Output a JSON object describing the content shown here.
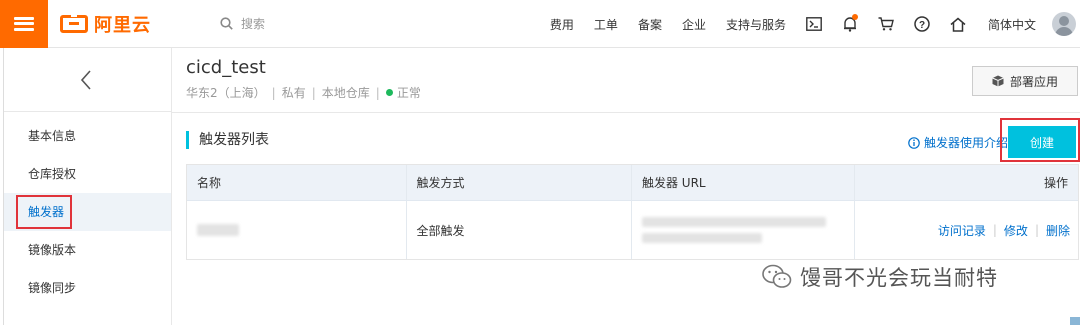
{
  "header": {
    "logo_text": "阿里云",
    "search_placeholder": "搜索",
    "nav": [
      "费用",
      "工单",
      "备案",
      "企业",
      "支持与服务"
    ],
    "language": "简体中文",
    "brand_color": "#ff6a00"
  },
  "sidebar": {
    "items": [
      {
        "label": "基本信息"
      },
      {
        "label": "仓库授权"
      },
      {
        "label": "触发器"
      },
      {
        "label": "镜像版本"
      },
      {
        "label": "镜像同步"
      }
    ]
  },
  "repo": {
    "name": "cicd_test",
    "region": "华东2（上海）",
    "visibility": "私有",
    "source": "本地仓库",
    "status": "正常",
    "deploy_label": "部署应用"
  },
  "section": {
    "title": "触发器列表",
    "help_link": "触发器使用介绍",
    "create_label": "创建"
  },
  "table": {
    "columns": [
      "名称",
      "触发方式",
      "触发器 URL",
      "操作"
    ],
    "rows": [
      {
        "trigger_type": "全部触发",
        "actions": [
          "访问记录",
          "修改",
          "删除"
        ]
      }
    ]
  },
  "watermark": "馒哥不光会玩当耐特",
  "colors": {
    "accent": "#00c1de",
    "link": "#0070cc",
    "highlight": "#e0333a",
    "ok": "#1db95c"
  }
}
